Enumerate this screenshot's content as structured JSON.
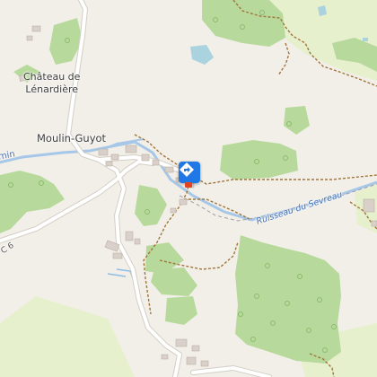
{
  "map": {
    "colors": {
      "land": "#f2efe9",
      "forest": "#b8d99c",
      "forest_dark": "#a9cf8a",
      "meadow": "#e6f0cd",
      "water": "#aad3df",
      "river": "#a6c7e8",
      "road": "#ffffff",
      "road_casing": "#d3cfc6",
      "path": "#a0753b",
      "building": "#d9d0c9",
      "poi": "#1f78e6",
      "poi_marker": "#e04420"
    },
    "labels": {
      "chateau_line1": "Château de",
      "chateau_line2": "Lénardière",
      "moulin": "Moulin-Guyot",
      "edge_left": "min",
      "road_ref": "C 6",
      "river": "Ruisseau du Sevreau"
    },
    "poi": {
      "icon": "direction-arrow-icon"
    }
  }
}
